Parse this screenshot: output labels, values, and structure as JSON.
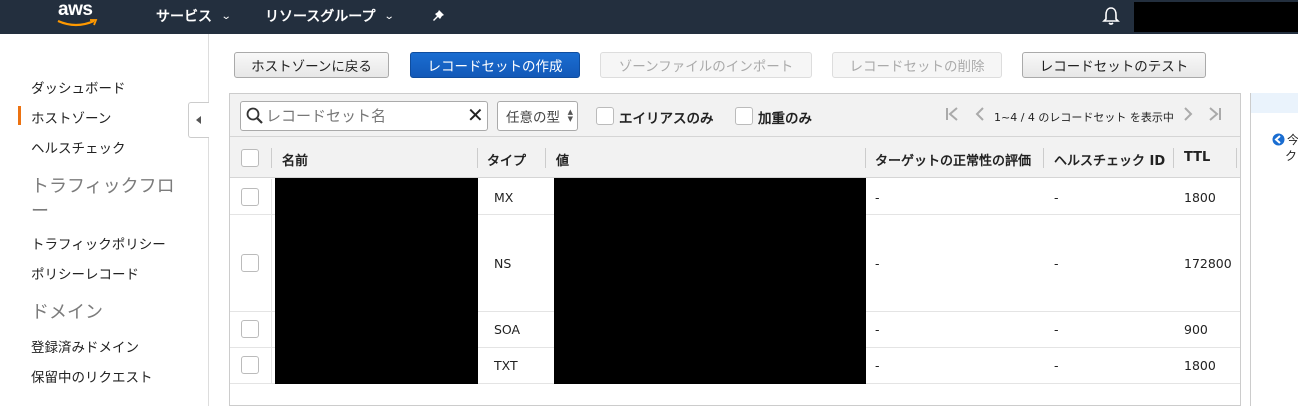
{
  "nav": {
    "logo": "aws",
    "services": "サービス",
    "resource_groups": "リソースグループ",
    "pin_icon": "pushpin-icon",
    "bell_icon": "bell-icon"
  },
  "sidebar": {
    "items": [
      {
        "label": "ダッシュボード",
        "active": false
      },
      {
        "label": "ホストゾーン",
        "active": true
      },
      {
        "label": "ヘルスチェック",
        "active": false
      }
    ],
    "traffic_heading_line1": "トラフィックフロ",
    "traffic_heading_line2": "ー",
    "traffic_items": [
      {
        "label": "トラフィックポリシー"
      },
      {
        "label": "ポリシーレコード"
      }
    ],
    "domain_heading": "ドメイン",
    "domain_items": [
      {
        "label": "登録済みドメイン"
      },
      {
        "label": "保留中のリクエスト"
      }
    ]
  },
  "actions": {
    "back": "ホストゾーンに戻る",
    "create": "レコードセットの作成",
    "import": "ゾーンファイルのインポート",
    "delete": "レコードセットの削除",
    "test": "レコードセットのテスト"
  },
  "filters": {
    "search_placeholder": "レコードセット名",
    "type_select": "任意の型",
    "alias_only": "エイリアスのみ",
    "weighted_only": "加重のみ",
    "pagination": "1~4 / 4 のレコードセット を表示中"
  },
  "table": {
    "columns": [
      "名前",
      "タイプ",
      "値",
      "ターゲットの正常性の評価",
      "ヘルスチェック ID",
      "TTL"
    ],
    "rows": [
      {
        "type": "MX",
        "health_eval": "-",
        "health_id": "-",
        "ttl": "1800"
      },
      {
        "type": "NS",
        "health_eval": "-",
        "health_id": "-",
        "ttl": "172800"
      },
      {
        "type": "SOA",
        "health_eval": "-",
        "health_id": "-",
        "ttl": "900"
      },
      {
        "type": "TXT",
        "health_eval": "-",
        "health_id": "-",
        "ttl": "1800"
      }
    ]
  },
  "right_panel": {
    "line1": "今",
    "line2": "ク"
  },
  "colors": {
    "nav_bg": "#232f3e",
    "primary": "#1a6dd1",
    "active_bar": "#ec7211"
  }
}
